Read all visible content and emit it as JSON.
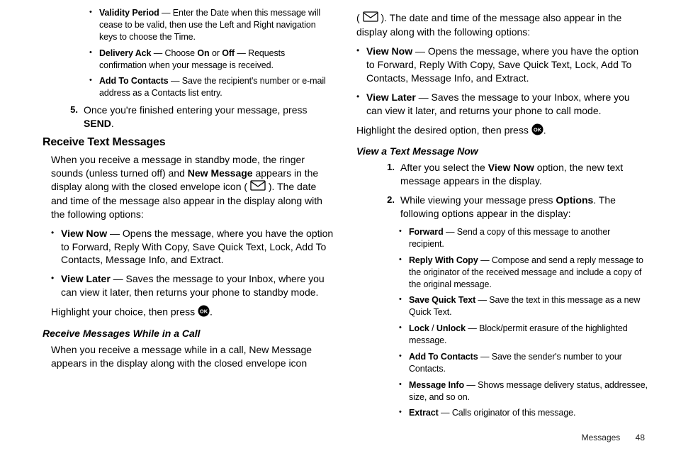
{
  "footer": {
    "section": "Messages",
    "page": "48"
  },
  "col1": {
    "bullets_top": [
      {
        "term": "Validity Period",
        "desc": " — Enter the Date when this message will cease to be valid, then use the Left and Right navigation keys to choose the Time."
      },
      {
        "term": "Delivery Ack",
        "desc_pre": " — Choose ",
        "opt1": "On",
        "mid": " or ",
        "opt2": "Off",
        "desc_post": " — Requests confirmation when your message is received."
      },
      {
        "term": "Add To Contacts",
        "desc": " — Save the recipient's number or e-mail address as a Contacts list entry."
      }
    ],
    "step5": {
      "num": "5.",
      "pre": "Once you're finished entering your message, press ",
      "key": "SEND",
      "post": "."
    },
    "h_receive": "Receive Text Messages",
    "p_receive_1a": "When you receive a message in standby mode, the ringer sounds (unless turned off) and ",
    "p_receive_1b": "New Message",
    "p_receive_1c": " appears in the display along with the closed envelope icon ( ",
    "p_receive_1d": " ). The date and time of the message also appear in the display along with the following options:",
    "bullets_vn": [
      {
        "term": "View Now",
        "desc": " — Opens the message, where you have the option to Forward, Reply With Copy, Save Quick Text, Lock, Add To Contacts, Message Info, and Extract."
      },
      {
        "term": "View Later",
        "desc": " — Saves the message to your Inbox, where you can view it later, then returns your phone to standby mode."
      }
    ],
    "p_highlight_a": "Highlight your choice, then press ",
    "p_highlight_b": ".",
    "h_incall": "Receive Messages While in a Call",
    "p_incall": "When you receive a message while in a call, New Message appears in the display along with the closed envelope icon"
  },
  "col2": {
    "p_cont_a": "( ",
    "p_cont_b": " ). The date and time of the message also appear in the display along with the following options:",
    "bullets_vn2": [
      {
        "term": "View Now",
        "desc": " — Opens the message, where you have the option to Forward, Reply With Copy, Save Quick Text, Lock, Add To Contacts, Message Info, and Extract."
      },
      {
        "term": "View Later",
        "desc": " — Saves the message to your Inbox, where you can view it later, and returns your phone to call mode."
      }
    ],
    "p_highlight2_a": "Highlight the desired option, then press ",
    "p_highlight2_b": ".",
    "h_viewnow": "View a Text Message Now",
    "steps": [
      {
        "num": "1.",
        "pre": "After you select the ",
        "b": "View Now",
        "post": " option, the new text message appears in the display."
      },
      {
        "num": "2.",
        "pre": "While viewing your message press ",
        "b": "Options",
        "post": ". The following options appear in the display:"
      }
    ],
    "opts": [
      {
        "term": "Forward",
        "desc": " — Send a copy of this message to another recipient."
      },
      {
        "term": "Reply With Copy",
        "desc": " — Compose and send a reply message to the originator of the received message and include a copy of the original message."
      },
      {
        "term": "Save Quick Text",
        "desc": " — Save the text in this message as a new Quick Text."
      },
      {
        "term": "Lock",
        "mid": " / ",
        "term2": "Unlock",
        "desc": " — Block/permit erasure of the highlighted message."
      },
      {
        "term": "Add To Contacts",
        "desc": " — Save the sender's number to your Contacts."
      },
      {
        "term": "Message Info",
        "desc": " — Shows message delivery status, addressee, size, and so on."
      },
      {
        "term": "Extract",
        "desc": " — Calls originator of this message."
      }
    ]
  }
}
